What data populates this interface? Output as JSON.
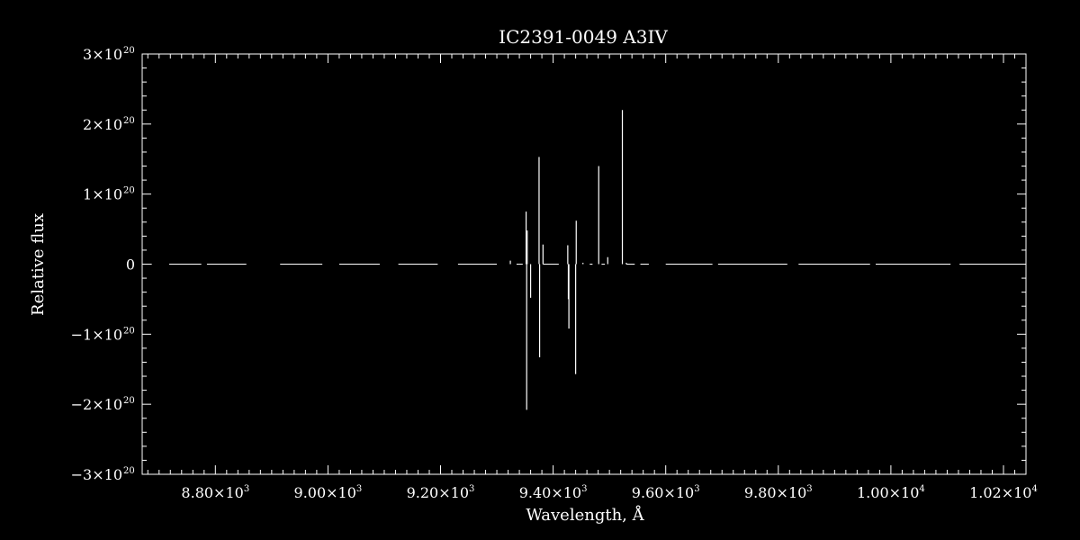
{
  "chart_data": {
    "type": "line",
    "title": "IC2391-0049   A3IV",
    "xlabel": "Wavelength, Å",
    "ylabel": "Relative flux",
    "xlim": [
      8670,
      10240
    ],
    "ylim": [
      -3e+20,
      3e+20
    ],
    "x_ticks": [
      {
        "value": 8800,
        "label": "8.80×10",
        "exp": "3"
      },
      {
        "value": 9000,
        "label": "9.00×10",
        "exp": "3"
      },
      {
        "value": 9200,
        "label": "9.20×10",
        "exp": "3"
      },
      {
        "value": 9400,
        "label": "9.40×10",
        "exp": "3"
      },
      {
        "value": 9600,
        "label": "9.60×10",
        "exp": "3"
      },
      {
        "value": 9800,
        "label": "9.80×10",
        "exp": "3"
      },
      {
        "value": 10000,
        "label": "1.00×10",
        "exp": "4"
      },
      {
        "value": 10200,
        "label": "1.02×10",
        "exp": "4"
      }
    ],
    "y_ticks": [
      {
        "value": 3e+20,
        "label": "3×10",
        "exp": "20"
      },
      {
        "value": 2e+20,
        "label": "2×10",
        "exp": "20"
      },
      {
        "value": 1e+20,
        "label": "1×10",
        "exp": "20"
      },
      {
        "value": 0,
        "label": "0",
        "exp": ""
      },
      {
        "value": -1e+20,
        "label": "−1×10",
        "exp": "20"
      },
      {
        "value": -2e+20,
        "label": "−2×10",
        "exp": "20"
      },
      {
        "value": -3e+20,
        "label": "−3×10",
        "exp": "20"
      }
    ],
    "baseline_segments": [
      [
        8673,
        8687
      ],
      [
        8718,
        8775
      ],
      [
        8785,
        8855
      ],
      [
        8915,
        8990
      ],
      [
        9020,
        9092
      ],
      [
        9125,
        9195
      ],
      [
        9231,
        9300
      ],
      [
        9335,
        9346
      ],
      [
        9382,
        9410
      ],
      [
        9465,
        9470
      ],
      [
        9486,
        9492
      ],
      [
        9530,
        9545
      ],
      [
        9555,
        9570
      ],
      [
        9600,
        9683
      ],
      [
        9693,
        9816
      ],
      [
        9836,
        9963
      ],
      [
        9973,
        10106
      ],
      [
        10122,
        10240
      ]
    ],
    "spikes": [
      {
        "x": 9324,
        "y": 5e+18
      },
      {
        "x": 9352,
        "y": 7.5e+19
      },
      {
        "x": 9353,
        "y": -2.08e+20
      },
      {
        "x": 9354,
        "y": 4.8e+19
      },
      {
        "x": 9360,
        "y": -4.8e+19
      },
      {
        "x": 9375,
        "y": 1.53e+20
      },
      {
        "x": 9376,
        "y": -1.33e+20
      },
      {
        "x": 9382,
        "y": 2.8e+19
      },
      {
        "x": 9426,
        "y": 2.7e+19
      },
      {
        "x": 9427,
        "y": -5e+19
      },
      {
        "x": 9428,
        "y": -9.2e+19
      },
      {
        "x": 9440,
        "y": -1.57e+20
      },
      {
        "x": 9441,
        "y": 6.2e+19
      },
      {
        "x": 9453,
        "y": 2e+18
      },
      {
        "x": 9481,
        "y": 1.4e+20
      },
      {
        "x": 9497,
        "y": 1e+19
      },
      {
        "x": 9523,
        "y": 2.2e+20
      },
      {
        "x": 9530,
        "y": 2e+18
      }
    ],
    "grid": false,
    "legend": "none"
  }
}
